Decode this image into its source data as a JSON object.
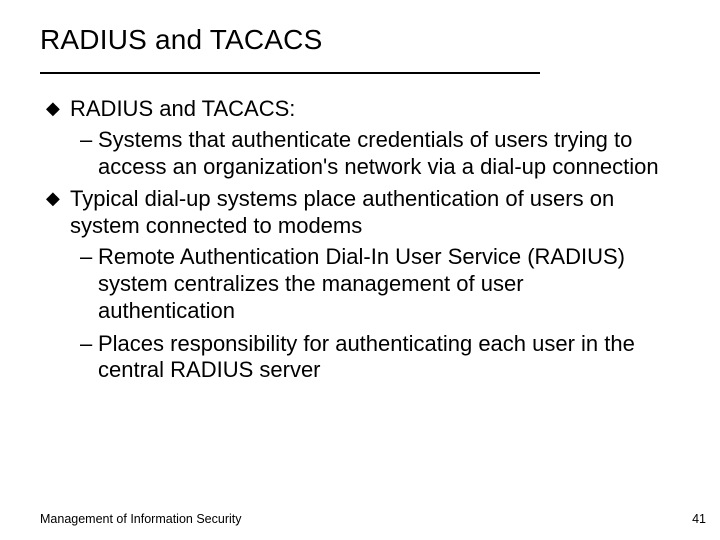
{
  "title": "RADIUS and TACACS",
  "bullets": {
    "b1": {
      "text": "RADIUS and TACACS:",
      "sub1": "Systems that authenticate credentials of users trying to access an organization's network via a dial-up connection"
    },
    "b2": {
      "text": "Typical dial-up systems place authentication of users on system connected to modems",
      "sub1": "Remote Authentication Dial-In User Service (RADIUS) system centralizes the management of user authentication",
      "sub2": "Places responsibility for authenticating each user in the central RADIUS server"
    }
  },
  "footer": {
    "left": "Management of Information Security",
    "page": "41"
  }
}
